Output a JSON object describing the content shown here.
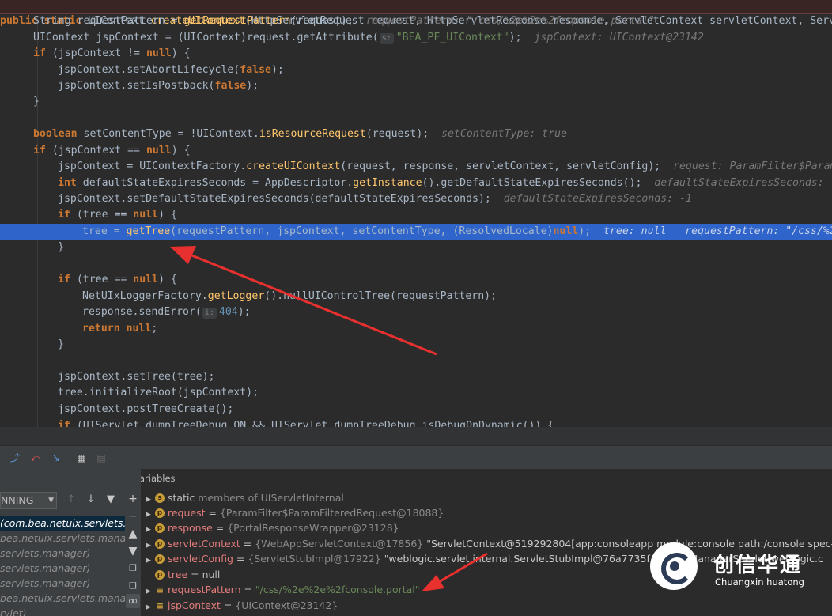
{
  "code": {
    "l1": {
      "a": "public static ",
      "b": "UIContext ",
      "c": "createUIContext",
      "d": "(HttpServletRequest request, HttpServletResponse response, ServletContext servletContext, ServletC"
    },
    "l2": {
      "a": "String requestPattern = ",
      "b": "getRequestPattern",
      "c": "(request);",
      "hint": "requestPattern: \"/css/%2e%2e%2fconsole.portal\""
    },
    "l3": {
      "a": "UIContext jspContext = (UIContext)request.getAttribute(",
      "tag": "s:",
      "str": "\"BEA_PF_UIContext\"",
      "c": ");",
      "hint": "jspContext: UIContext@23142"
    },
    "l4": {
      "kw": "if",
      "a": " (jspContext != ",
      "kw2": "null",
      "b": ") {"
    },
    "l5": {
      "a": "jspContext.setAbortLifecycle(",
      "kw": "false",
      "b": ");"
    },
    "l6": {
      "a": "jspContext.setIsPostback(",
      "kw": "false",
      "b": ");"
    },
    "l7": {
      "a": "}"
    },
    "l8": {
      "kw": "boolean",
      "a": " setContentType = !UIContext.",
      "b": "isResourceRequest",
      "c": "(request);",
      "hint": "setContentType: true"
    },
    "l9": {
      "kw": "if",
      "a": " (jspContext == ",
      "kw2": "null",
      "b": ") {"
    },
    "l10": {
      "a": "jspContext = UIContextFactory.",
      "b": "createUIContext",
      "c": "(request, response, servletContext, servletConfig);",
      "hint": "request: ParamFilter$ParamFi"
    },
    "l11": {
      "kw": "int",
      "a": " defaultStateExpiresSeconds = AppDescriptor.",
      "b": "getInstance",
      "c": "().getDefaultStateExpiresSeconds();",
      "hint": "defaultStateExpiresSeconds: -1"
    },
    "l12": {
      "a": "jspContext.setDefaultStateExpiresSeconds(defaultStateExpiresSeconds);",
      "hint": "defaultStateExpiresSeconds: -1"
    },
    "l13": {
      "kw": "if",
      "a": " (tree == ",
      "kw2": "null",
      "b": ") {"
    },
    "l14": {
      "a": "tree = ",
      "b": "getTree",
      "c": "(requestPattern, jspContext, setContentType, (ResolvedLocale)",
      "kw": "null",
      "d": ");",
      "hint": "tree: null   requestPattern: \"/css/%2e%2"
    },
    "l15": {
      "a": "}"
    },
    "l16": {
      "kw": "if",
      "a": " (tree == ",
      "kw2": "null",
      "b": ") {"
    },
    "l17": {
      "a": "NetUIxLoggerFactory.",
      "b": "getLogger",
      "c": "().nullUIControlTree(requestPattern);"
    },
    "l18": {
      "a": "response.sendError(",
      "tag": "i:",
      "num": "404",
      "b": ");"
    },
    "l19": {
      "kw": "return",
      "a": " ",
      "kw2": "null",
      "b": ";"
    },
    "l20": {
      "a": "}"
    },
    "l21": {
      "a": "jspContext.setTree(tree);"
    },
    "l22": {
      "a": "tree.initializeRoot(jspContext);"
    },
    "l23": {
      "a": "jspContext.postTreeCreate();"
    },
    "l24": {
      "kw": "if",
      "a": " (UIServlet.dumpTreeDebug_ON && UIServlet.dumpTreeDebug.isDebugOnDynamic()) {"
    }
  },
  "debugger": {
    "state_combo": "NNING",
    "variables_title": "Variables",
    "frames": [
      {
        "label": "(com.bea.netuix.servlets.",
        "selected": true
      },
      {
        "label": "bea.netuix.servlets.manag",
        "selected": false
      },
      {
        "label": "servlets.manager)",
        "selected": false
      },
      {
        "label": "servlets.manager)",
        "selected": false
      },
      {
        "label": "servlets.manager)",
        "selected": false
      },
      {
        "label": "bea.netuix.servlets.manager.",
        "selected": false
      },
      {
        "label": "rvlet)",
        "selected": false
      }
    ],
    "variables": [
      {
        "icon": "s",
        "name": "static",
        "rest": " members of UIServletInternal",
        "value": "",
        "desc": ""
      },
      {
        "icon": "p",
        "name": "request",
        "rest": " = ",
        "value": "{ParamFilter$ParamFilteredRequest@18088}",
        "desc": ""
      },
      {
        "icon": "p",
        "name": "response",
        "rest": " = ",
        "value": "{PortalResponseWrapper@23128}",
        "desc": ""
      },
      {
        "icon": "p",
        "name": "servletContext",
        "rest": " = ",
        "value": "{WebAppServletContext@17856}",
        "desc": "\"ServletContext@519292804[app:consoleapp module:console path:/console spec-ve"
      },
      {
        "icon": "p",
        "name": "servletConfig",
        "rest": " = ",
        "value": "{ServletStubImpl@17922}",
        "desc": "\"weblogic.servlet.internal.ServletStubImpl@76a7735f - AsyncManagerServlet:weblogic.c"
      },
      {
        "icon": "p",
        "name": "tree",
        "rest": " = null",
        "value": "",
        "desc": ""
      },
      {
        "icon": "list",
        "name": "requestPattern",
        "rest": " = ",
        "value": "",
        "string": "\"/css/%2e%2e%2fconsole.portal\"",
        "desc": ""
      },
      {
        "icon": "list",
        "name": "jspContext",
        "rest": " = ",
        "value": "{UIContext@23142}",
        "desc": ""
      }
    ]
  },
  "watermark": {
    "cn": "创信华通",
    "en": "Chuangxin huatong"
  },
  "colors": {
    "selection": "#2f65ca",
    "arrow": "#e8312f",
    "keyword": "#cc7832",
    "string": "#6a8759"
  }
}
